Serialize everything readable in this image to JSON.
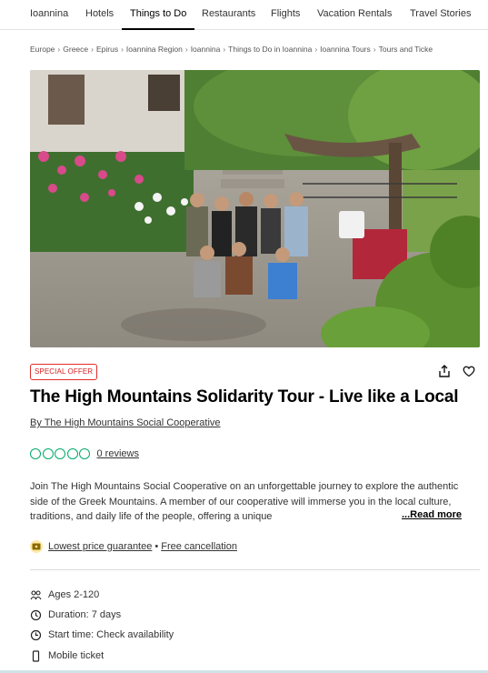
{
  "nav": {
    "tabs": [
      {
        "label": "Ioannina",
        "active": false
      },
      {
        "label": "Hotels",
        "active": false
      },
      {
        "label": "Things to Do",
        "active": true
      },
      {
        "label": "Restaurants",
        "active": false
      },
      {
        "label": "Flights",
        "active": false
      },
      {
        "label": "Vacation Rentals",
        "active": false
      },
      {
        "label": "Travel Stories",
        "active": false
      }
    ]
  },
  "breadcrumb": [
    "Europe",
    "Greece",
    "Epirus",
    "Ioannina Region",
    "Ioannina",
    "Things to Do in Ioannina",
    "Ioannina Tours",
    "Tours and Ticke"
  ],
  "badge": "SPECIAL OFFER",
  "actions": {
    "share_icon": "share-icon",
    "save_icon": "heart-icon"
  },
  "title": "The High Mountains Solidarity Tour - Live like a Local",
  "byline": "By The High Mountains Social Cooperative",
  "rating": {
    "bubbles": 5,
    "filled": 0,
    "reviews": "0 reviews",
    "color": "#00aa6c"
  },
  "description": {
    "text": "Join The High Mountains Social Cooperative on an unforgettable journey to explore the authentic side of the Greek Mountains. A member of our cooperative will immerse you in the local culture, traditions, and daily life of the people, offering a unique",
    "fade": "...",
    "read_more": "...Read more"
  },
  "guarantee": {
    "icon": "ticket-icon",
    "price": "Lowest price guarantee",
    "separator": "•",
    "cancel": "Free cancellation"
  },
  "features": [
    {
      "icon": "people-icon",
      "label": "Ages 2-120"
    },
    {
      "icon": "timer-icon",
      "label": "Duration: 7 days"
    },
    {
      "icon": "clock-icon",
      "label": "Start time: Check availability"
    },
    {
      "icon": "phone-icon",
      "label": "Mobile ticket"
    }
  ]
}
